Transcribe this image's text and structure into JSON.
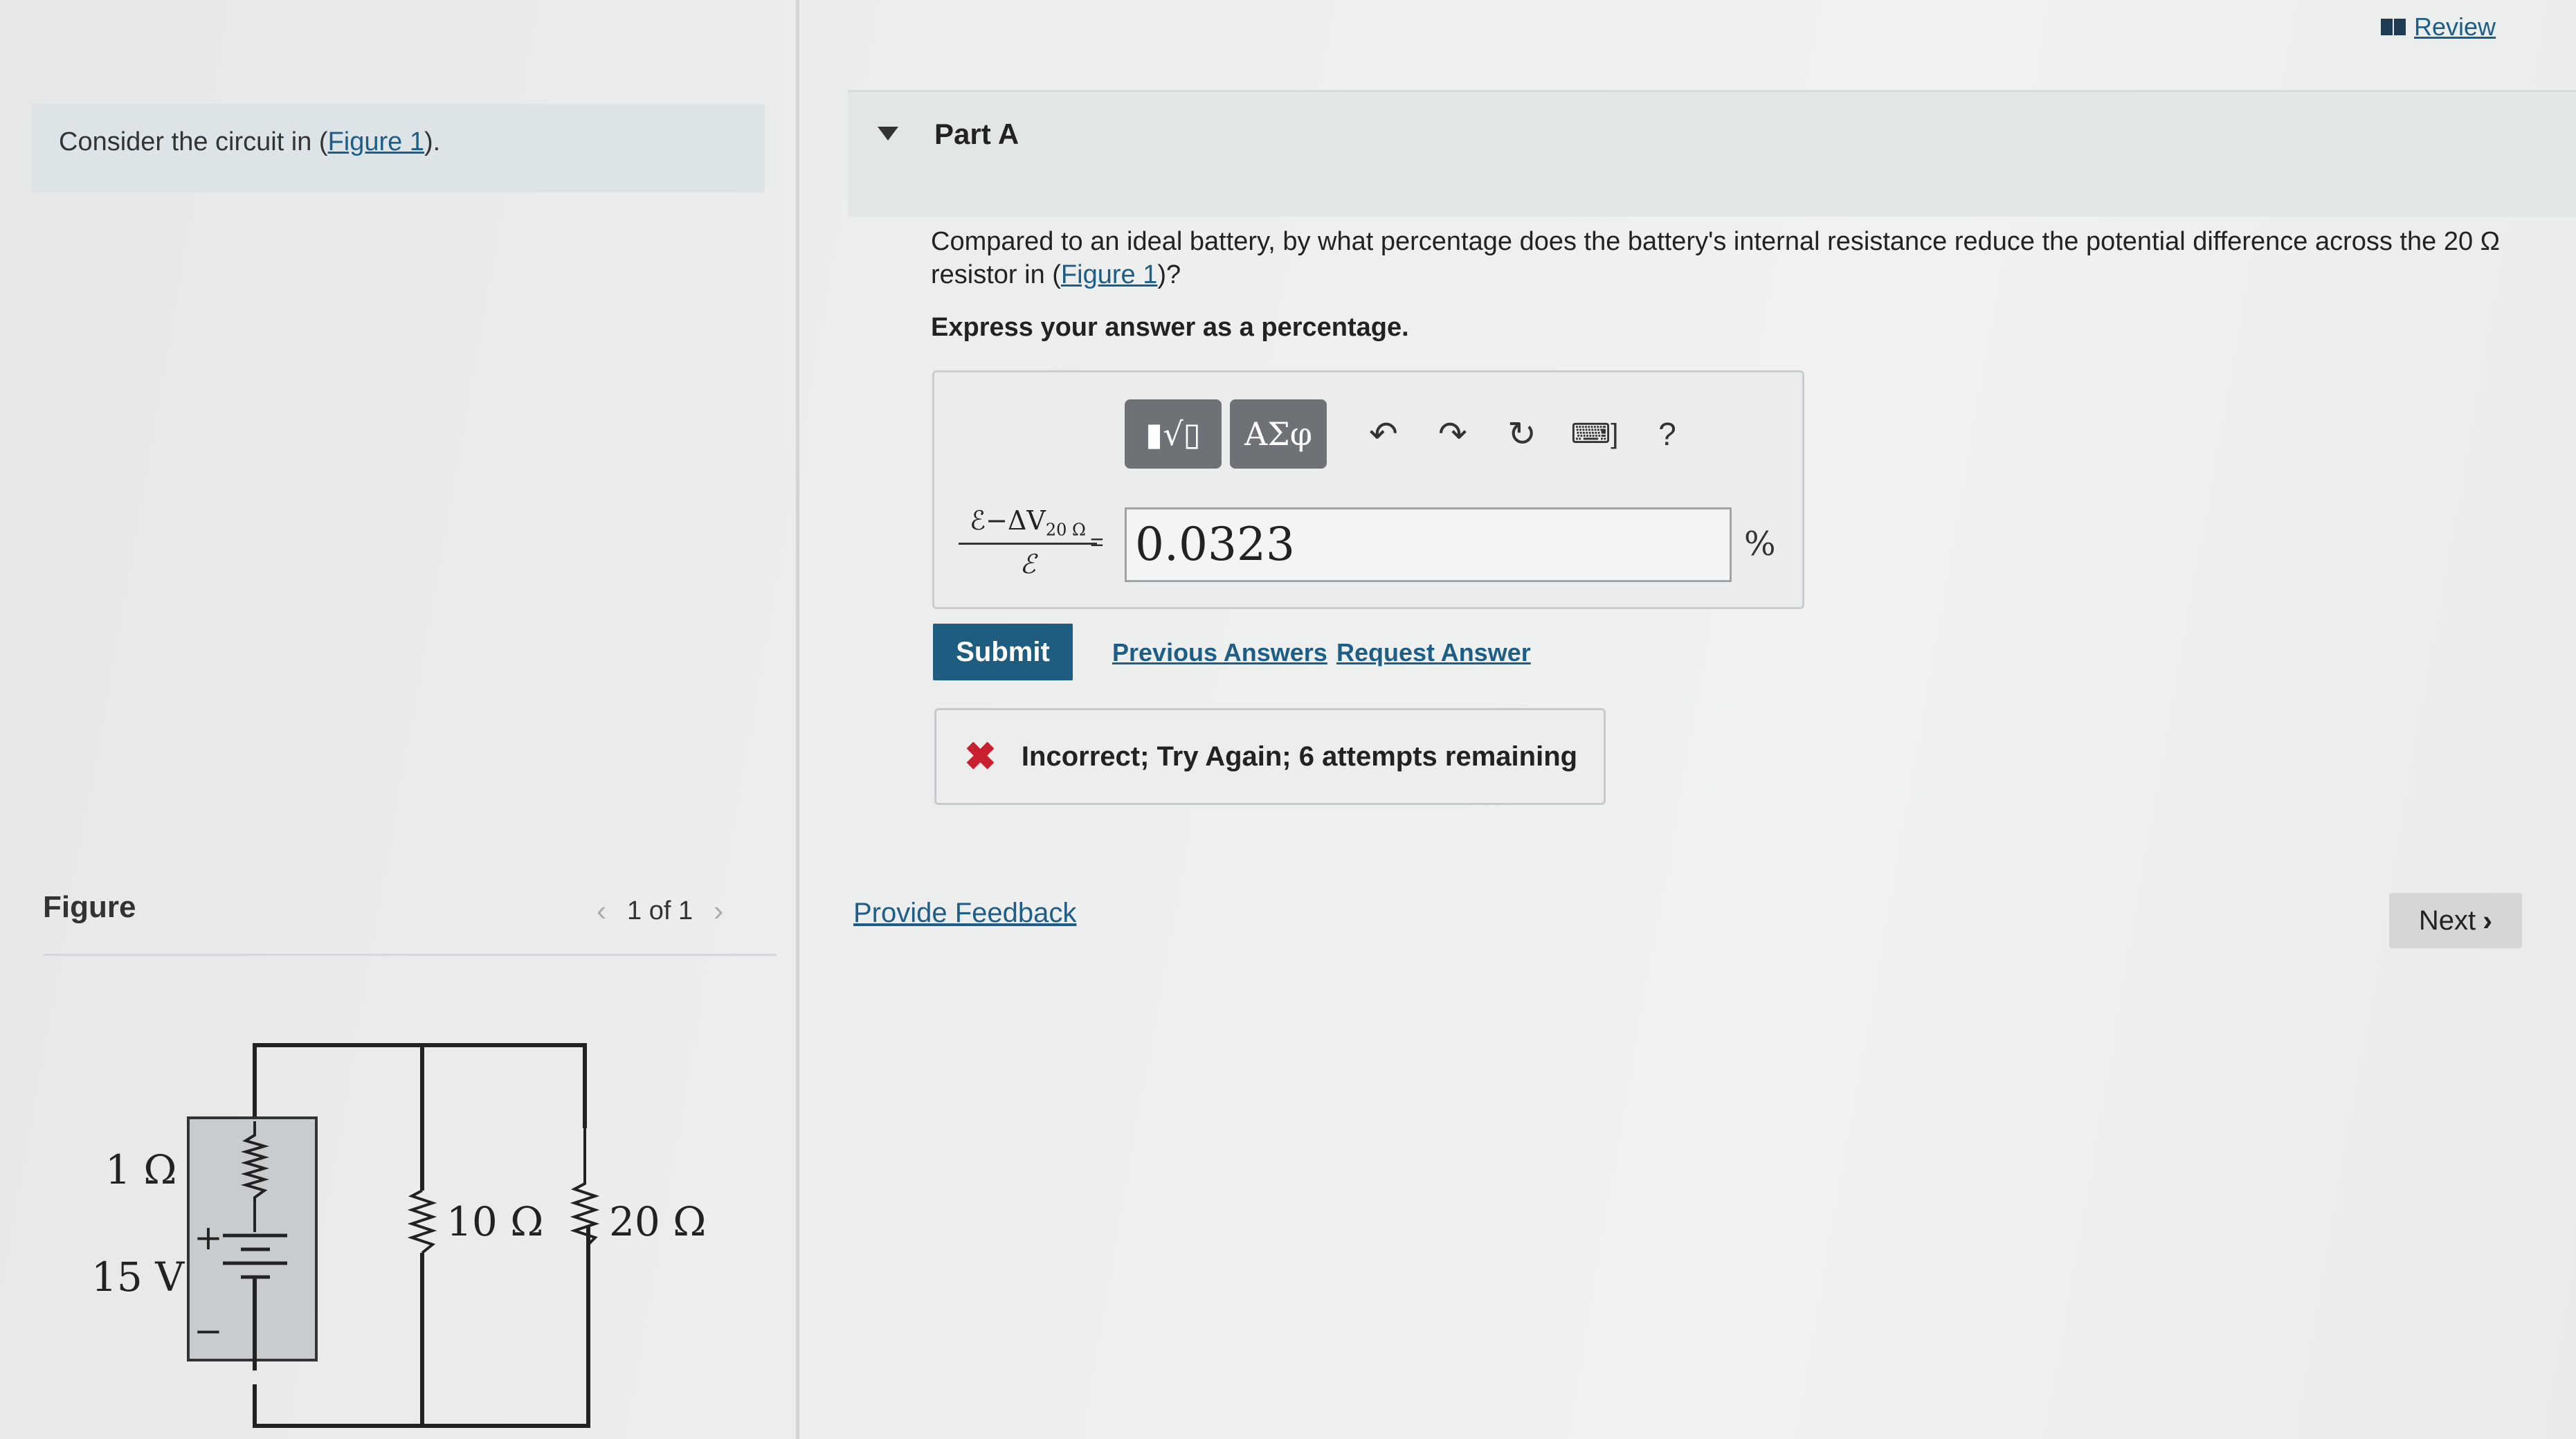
{
  "review": {
    "label": "Review",
    "icon": "book-icon"
  },
  "intro": {
    "text_before": "Consider the circuit in (",
    "link": "Figure 1",
    "text_after": ")."
  },
  "figure": {
    "title": "Figure",
    "pager": "1 of 1",
    "prev_icon": "chevron-left-icon",
    "next_icon": "chevron-right-icon",
    "labels": {
      "r_internal": "1 Ω",
      "emf": "15 V",
      "r1": "10 Ω",
      "r2": "20 Ω",
      "plus": "+",
      "minus": "−"
    }
  },
  "part": {
    "title": "Part A",
    "question_before": "Compared to an ideal battery, by what percentage does the battery's internal resistance reduce the potential difference across the 20 Ω resistor in (",
    "question_link": "Figure 1",
    "question_after": ")?",
    "express": "Express your answer as a percentage."
  },
  "toolbar": {
    "template_btn": "▮√▯",
    "greek_btn": "ΑΣφ",
    "undo": "↶",
    "redo": "↷",
    "reset": "↻",
    "keyboard": "⌨]",
    "help": "?"
  },
  "answer": {
    "label_num": "ℰ−ΔV",
    "label_sub": "20 Ω",
    "label_den": "ℰ",
    "equals": "=",
    "value": "0.0323",
    "unit": "%"
  },
  "actions": {
    "submit": "Submit",
    "previous": "Previous Answers",
    "request": "Request Answer"
  },
  "feedback": {
    "icon": "✖",
    "text": "Incorrect; Try Again; 6 attempts remaining"
  },
  "footer": {
    "provide_feedback": "Provide Feedback",
    "next": "Next",
    "next_icon": "›"
  },
  "colors": {
    "link": "#1d5d86",
    "submit": "#1e5d80",
    "error": "#c8202e"
  }
}
